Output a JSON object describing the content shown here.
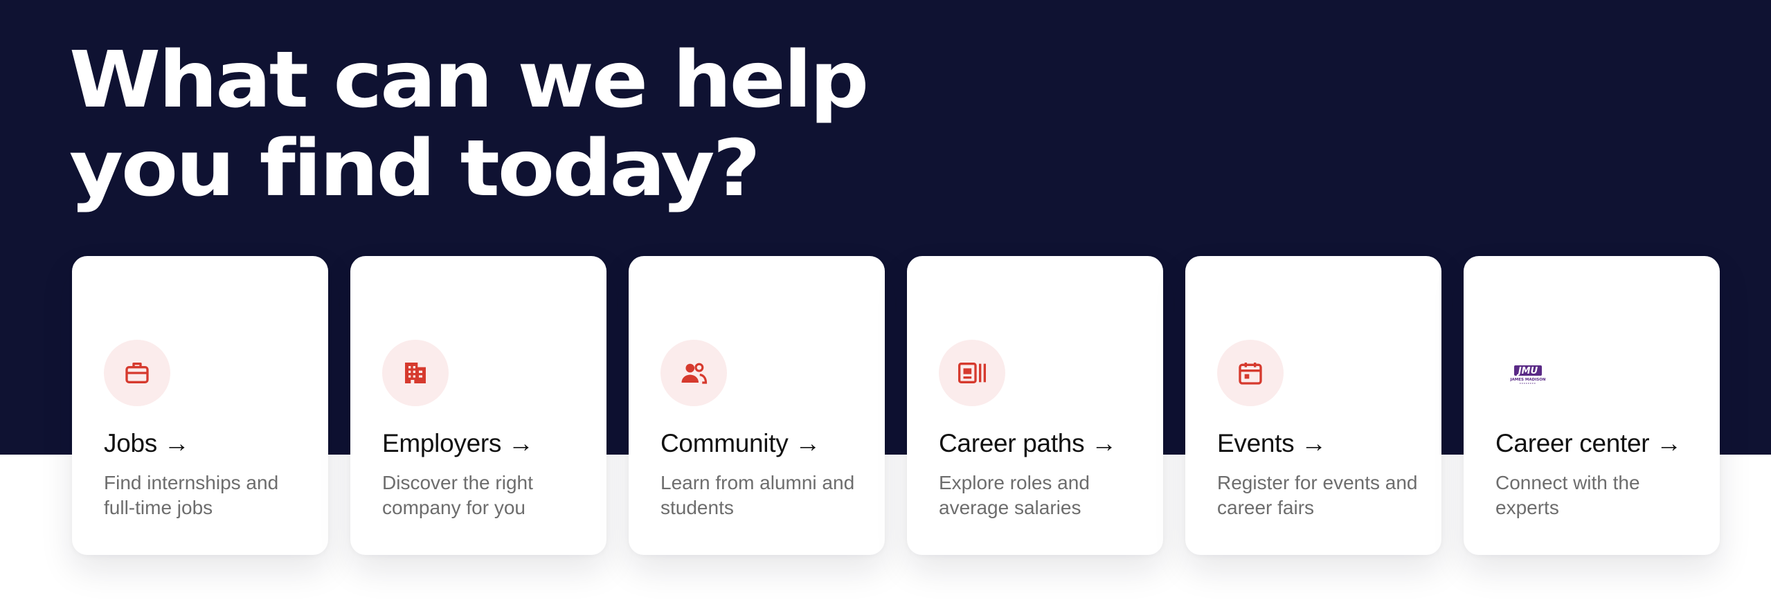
{
  "hero": {
    "line1": "What can we help",
    "line2": "you find today?"
  },
  "colors": {
    "hero_background": "#0f1232",
    "icon_accent": "#d63a2e",
    "icon_circle": "#fbecec",
    "logo_purple": "#5a2a86"
  },
  "cards": [
    {
      "title": "Jobs →",
      "description": "Find internships and full-time jobs",
      "icon": "briefcase-icon"
    },
    {
      "title": "Employers →",
      "description": "Discover the right company for you",
      "icon": "building-icon"
    },
    {
      "title": "Community →",
      "description": "Learn from alumni and students",
      "icon": "people-icon"
    },
    {
      "title": "Career paths →",
      "description": "Explore roles and average salaries",
      "icon": "newspaper-icon"
    },
    {
      "title": "Events →",
      "description": "Register for events and career fairs",
      "icon": "calendar-icon"
    },
    {
      "title": "Career center →",
      "description": "Connect with the experts",
      "icon": "jmu-logo",
      "logo_text": "JMU",
      "logo_subtext": "JAMES MADISON"
    }
  ]
}
